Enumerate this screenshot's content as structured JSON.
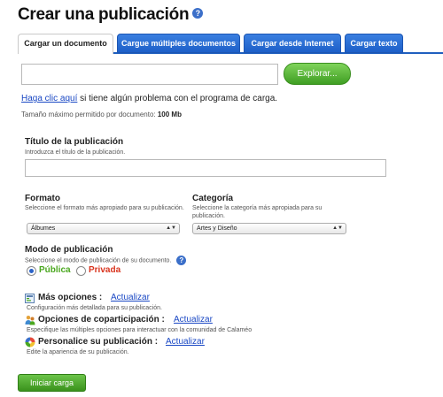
{
  "page": {
    "title": "Crear una publicación",
    "help_glyph": "?"
  },
  "tabs": [
    {
      "label": "Cargar un documento",
      "active": true
    },
    {
      "label": "Cargue múltiples documentos",
      "active": false
    },
    {
      "label": "Cargar desde Internet",
      "active": false
    },
    {
      "label": "Cargar texto",
      "active": false
    }
  ],
  "upload": {
    "file_value": "",
    "browse_label": "Explorar...",
    "help_link": "Haga clic aquí",
    "help_text": "si tiene algún problema con el programa de carga.",
    "max_size_label": "Tamaño máximo permitido por documento:",
    "max_size_value": "100 Mb"
  },
  "title_field": {
    "label": "Título de la publicación",
    "hint": "Introduzca el título de la publicación.",
    "value": ""
  },
  "format": {
    "label": "Formato",
    "hint": "Seleccione el formato más apropiado para su publicación.",
    "selected": "Álbumes"
  },
  "category": {
    "label": "Categoría",
    "hint": "Seleccione la categoría más apropiada para su publicación.",
    "selected": "Artes y Diseño"
  },
  "mode": {
    "label": "Modo de publicación",
    "hint": "Seleccione el modo de publicación de su documento.",
    "public_label": "Pública",
    "private_label": "Privada",
    "selected": "Pública",
    "public_color": "#4aa71f",
    "private_color": "#d9341e"
  },
  "options": [
    {
      "title": "Más opciones :",
      "link": "Actualizar",
      "desc": "Configuración más detallada para su publicación.",
      "icon": "settings-panel-icon"
    },
    {
      "title": "Opciones de coparticipación :",
      "link": "Actualizar",
      "desc": "Especifique las múltiples opciones para interactuar con la comunidad de Calaméo",
      "icon": "people-icon"
    },
    {
      "title": "Personalice su publicación :",
      "link": "Actualizar",
      "desc": "Edite la apariencia de su publicación.",
      "icon": "color-wheel-icon"
    }
  ],
  "submit_label": "Iniciar carga",
  "colors": {
    "tab_blue": "#1f5fbf",
    "button_green": "#3f9e23",
    "link_blue": "#1a48c4"
  }
}
